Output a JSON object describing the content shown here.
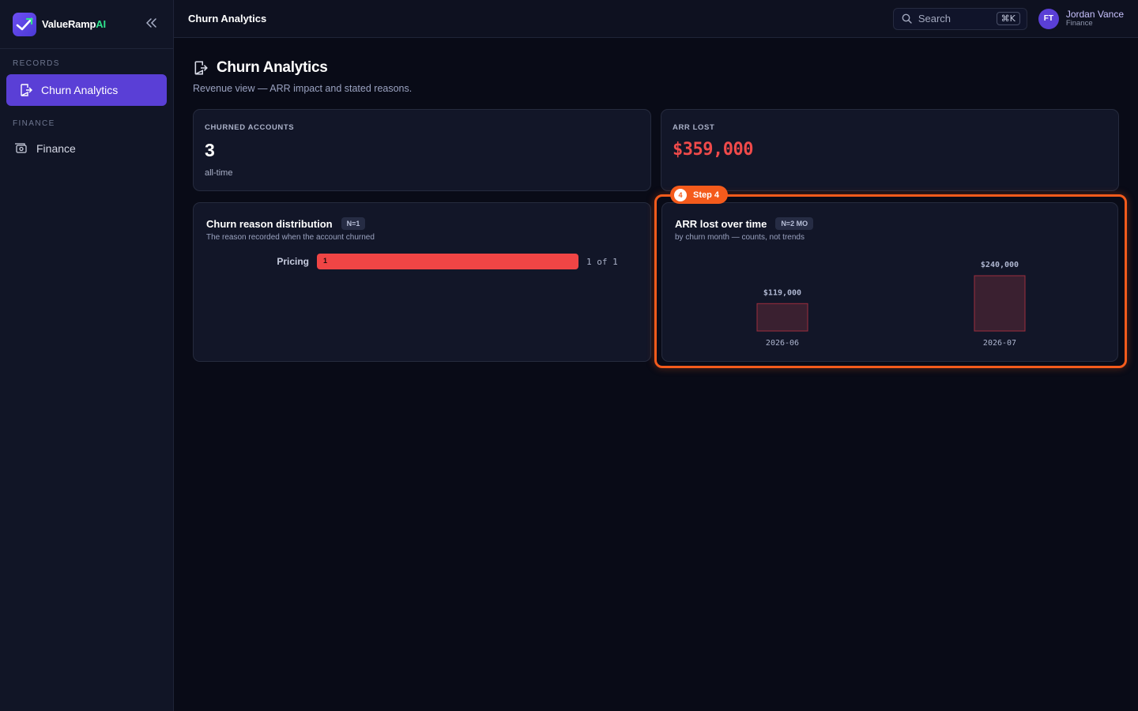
{
  "brand": {
    "name_main": "ValueRamp",
    "name_accent": "AI"
  },
  "sidebar": {
    "sections": [
      {
        "label": "RECORDS",
        "items": [
          {
            "label": "Churn Analytics",
            "icon": "exit-door-icon",
            "active": true
          }
        ]
      },
      {
        "label": "FINANCE",
        "items": [
          {
            "label": "Finance",
            "icon": "money-icon",
            "active": false
          }
        ]
      }
    ]
  },
  "topbar": {
    "title": "Churn Analytics",
    "search_placeholder": "Search",
    "shortcut": "⌘K",
    "user": {
      "initials": "FT",
      "name": "Jordan Vance",
      "role": "Finance"
    }
  },
  "page": {
    "title": "Churn Analytics",
    "subtitle": "Revenue view — ARR impact and stated reasons."
  },
  "stats": [
    {
      "label": "CHURNED ACCOUNTS",
      "value": "3",
      "foot": "all-time"
    },
    {
      "label": "ARR LOST",
      "value": "$359,000",
      "color": "#f04a4a"
    }
  ],
  "reasons_panel": {
    "title": "Churn reason distribution",
    "pill": "N=1",
    "subtitle": "The reason recorded when the account churned",
    "rows": [
      {
        "label": "Pricing",
        "value": 1,
        "count_text": "1 of 1"
      }
    ],
    "bar_color": "#f04545"
  },
  "step": {
    "number": "4",
    "label": "Step 4",
    "color": "#f45b1c"
  },
  "arr_panel": {
    "title": "ARR lost over time",
    "pill": "N=2 MO",
    "subtitle": "by churn month — counts, not trends"
  },
  "chart_data": {
    "type": "bar",
    "categories": [
      "2026-06",
      "2026-07"
    ],
    "values": [
      119000,
      240000
    ],
    "value_labels": [
      "$119,000",
      "$240,000"
    ],
    "ylim": [
      0,
      240000
    ],
    "grid": false
  }
}
